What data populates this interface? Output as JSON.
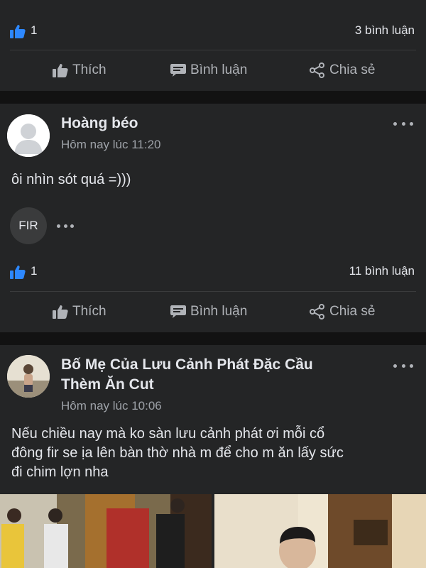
{
  "post1": {
    "like_count": "1",
    "comment_count": "3 bình luận",
    "actions": {
      "like": "Thích",
      "comment": "Bình luận",
      "share": "Chia sẻ"
    }
  },
  "post2": {
    "author": "Hoàng béo",
    "time": "Hôm nay lúc 11:20",
    "text": "ôi nhìn sót quá =)))",
    "reactor_badge": "FIR",
    "like_count": "1",
    "comment_count": "11 bình luận",
    "actions": {
      "like": "Thích",
      "comment": "Bình luận",
      "share": "Chia sẻ"
    }
  },
  "post3": {
    "author_line1": "Bố Mẹ Của Lưu Cảnh Phát  Đặc Cầu",
    "author_line2": "Thèm Ăn Cut",
    "time": "Hôm nay lúc 10:06",
    "text_line1": "Nếu chiều nay mà ko sàn lưu cảnh phát ơi  mỗi cổ",
    "text_line2": "đông fir se ịa lên bàn thờ nhà m để cho m ăn lấy sức",
    "text_line3": "đi chim lợn nha"
  },
  "colors": {
    "background": "#121212",
    "card": "#242526",
    "like_blue": "#2d88ff",
    "muted": "#b0b3b8"
  }
}
